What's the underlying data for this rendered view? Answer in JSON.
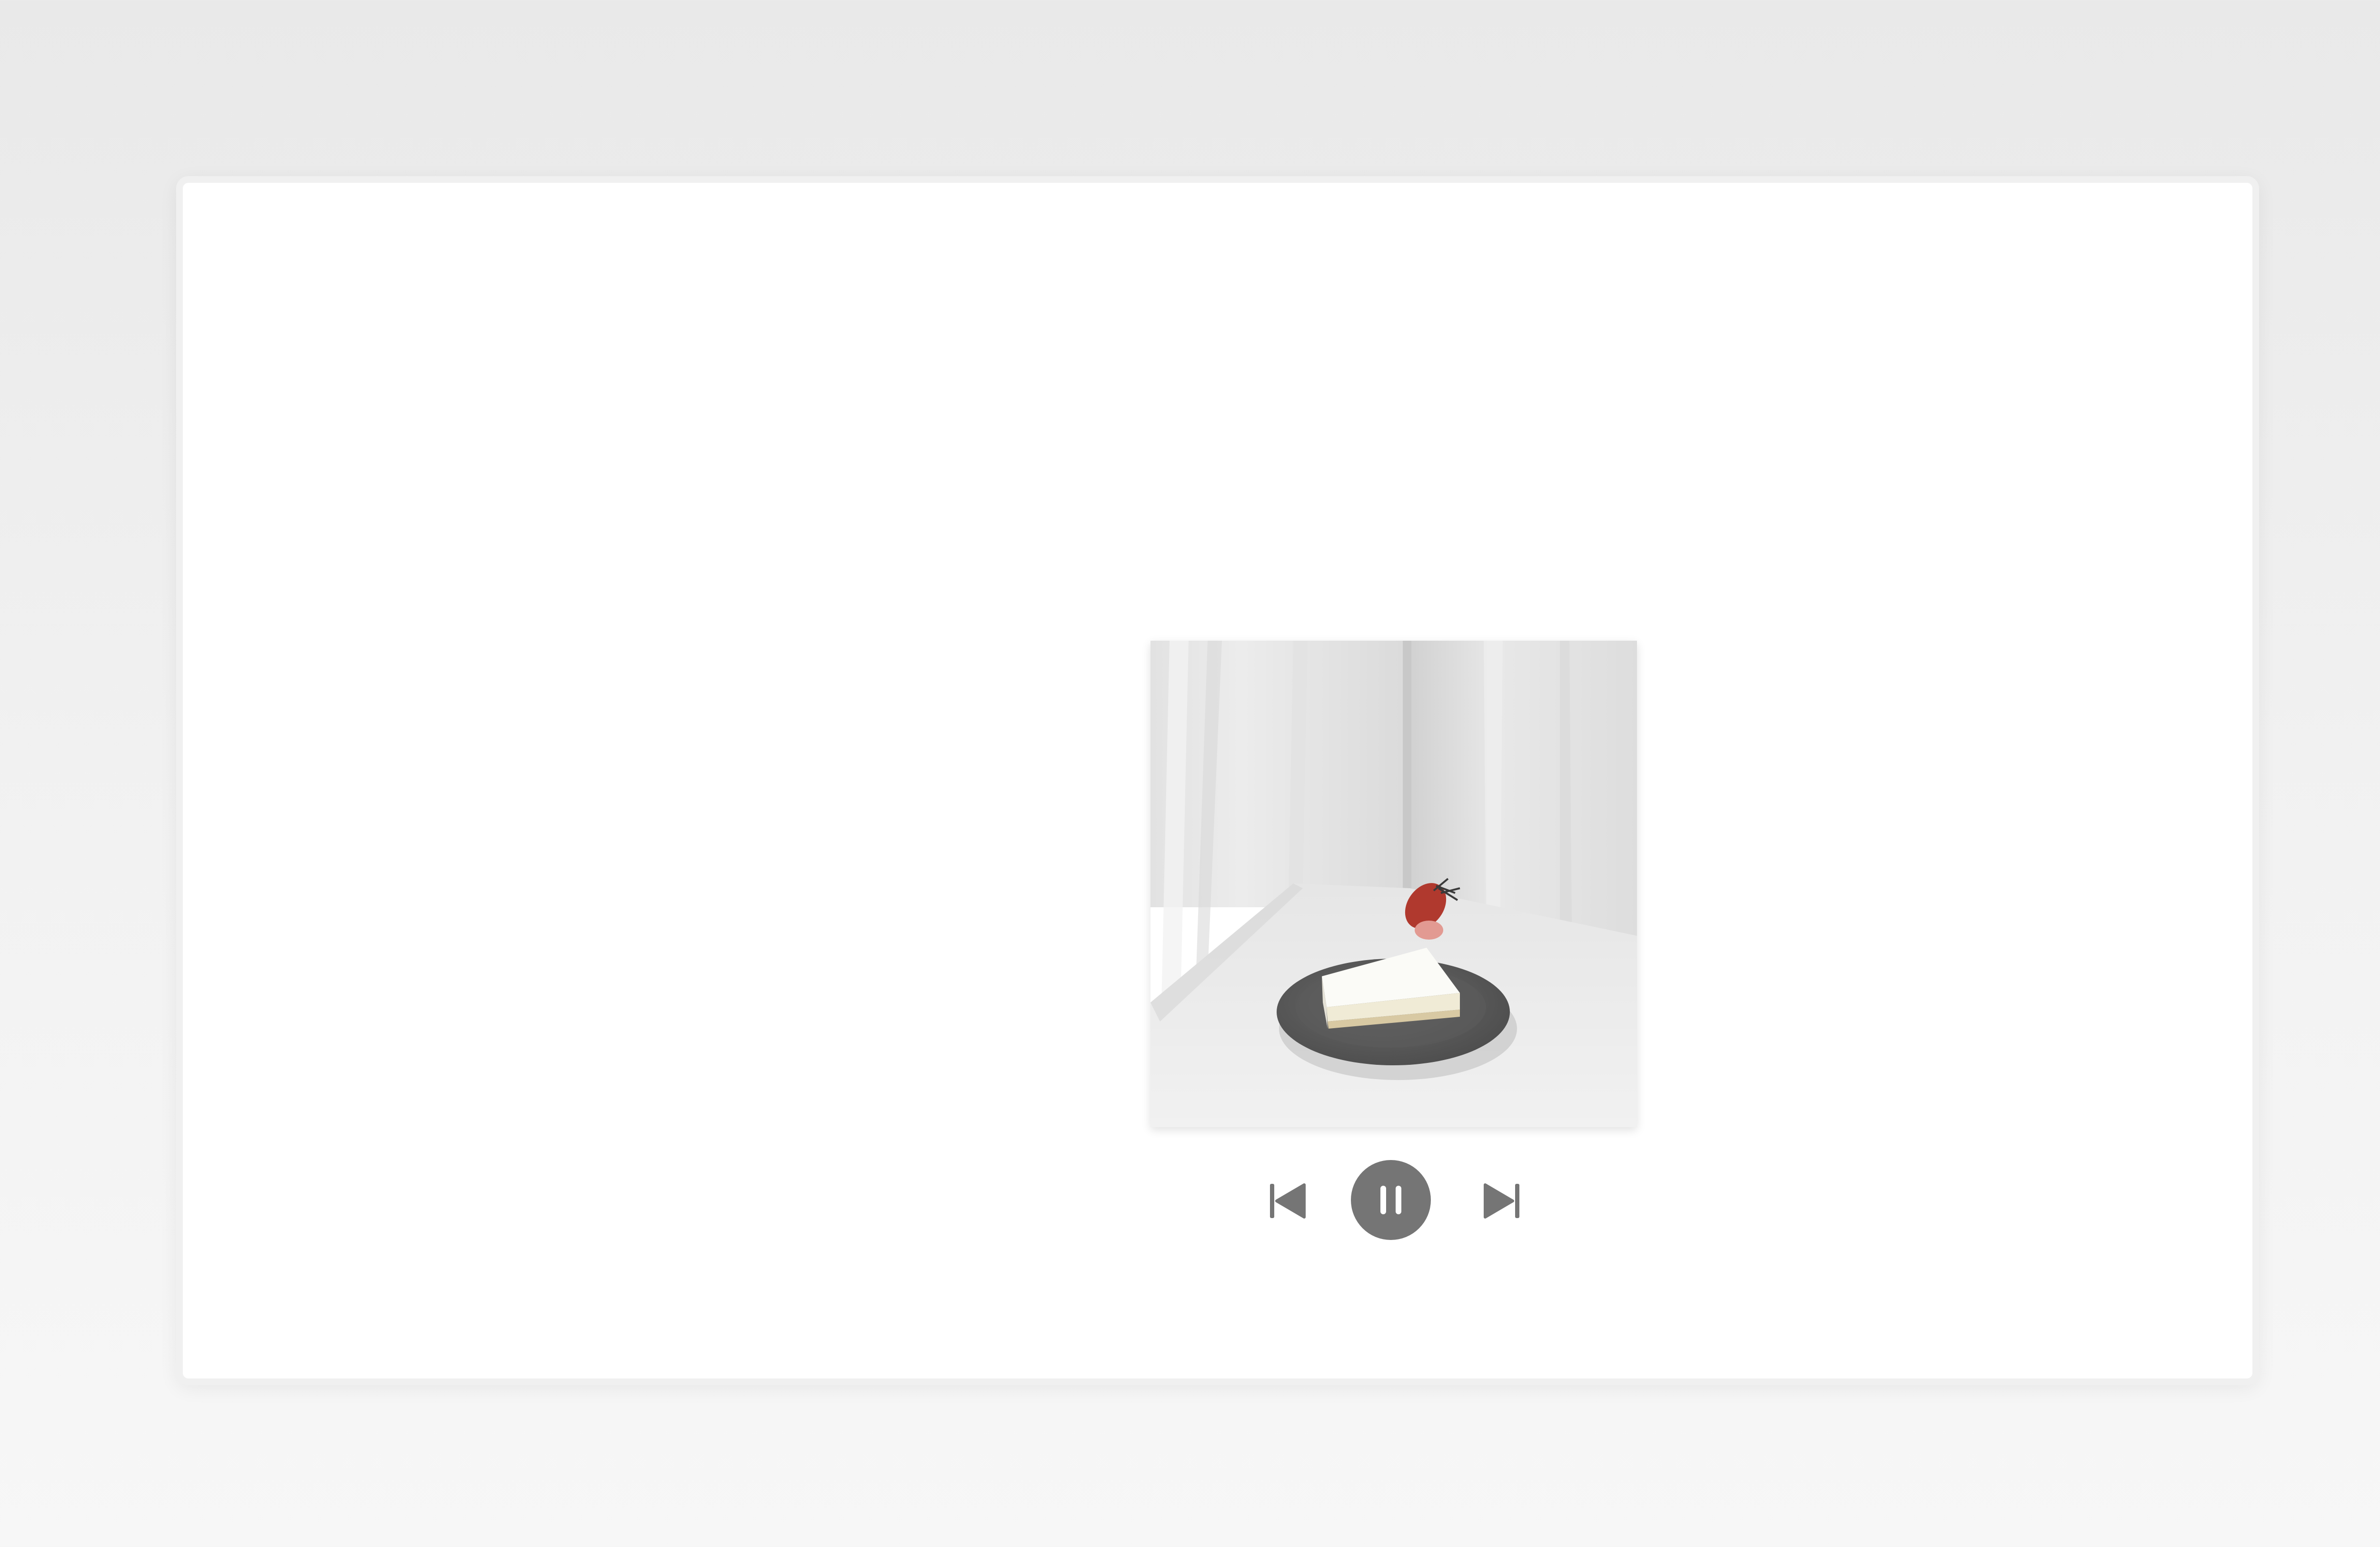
{
  "player": {
    "album_art_icon": "album-art-image",
    "controls": {
      "previous_icon": "skip-previous-icon",
      "play_pause_icon": "pause-icon",
      "next_icon": "skip-next-icon"
    },
    "colors": {
      "control": "#757575",
      "window": "#ffffff"
    }
  }
}
